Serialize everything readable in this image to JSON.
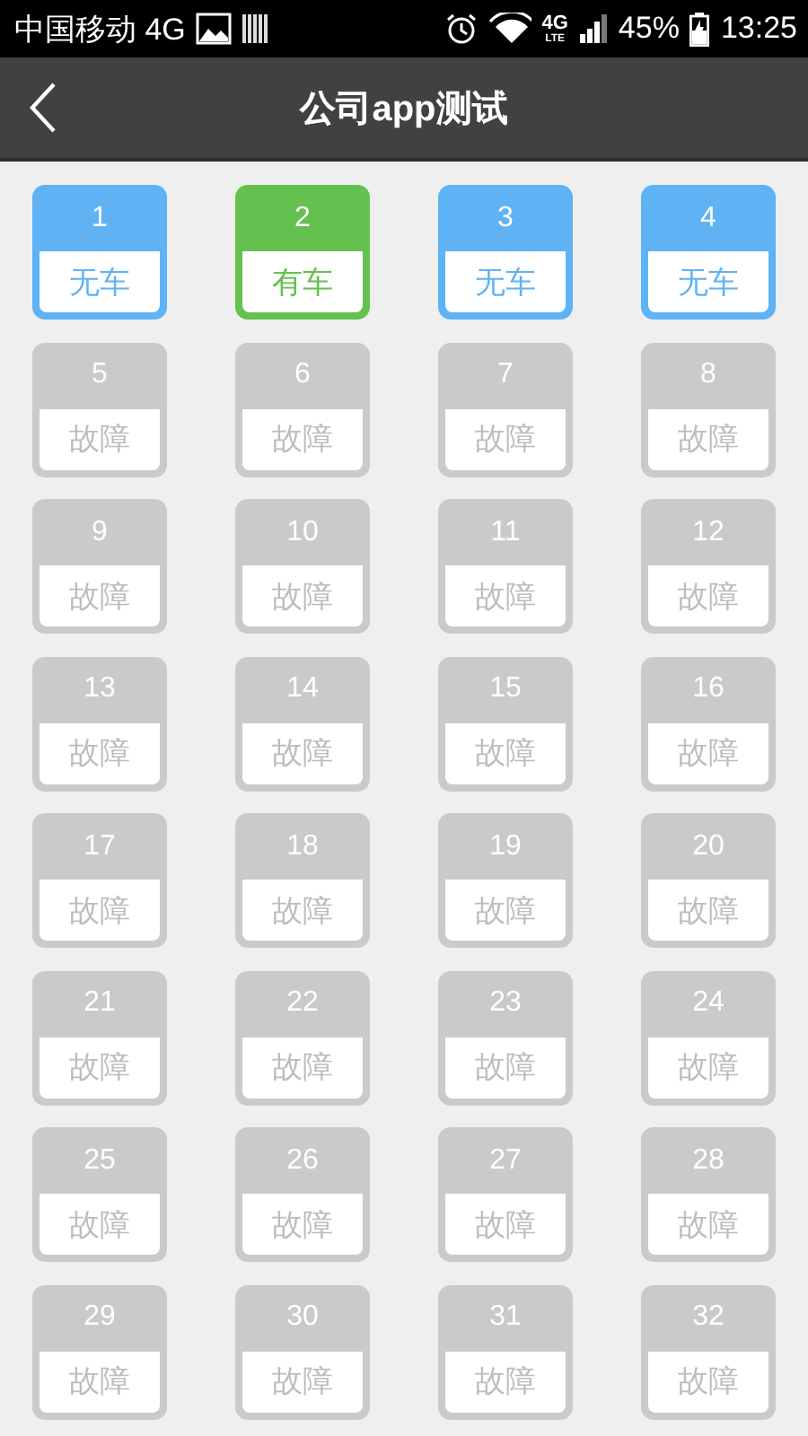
{
  "status_bar": {
    "carrier": "中国移动 4G",
    "network": "4G",
    "network_sub": "LTE",
    "battery": "45%",
    "time": "13:25"
  },
  "header": {
    "title": "公司app测试"
  },
  "slots": [
    {
      "number": "1",
      "status": "无车",
      "kind": "empty"
    },
    {
      "number": "2",
      "status": "有车",
      "kind": "occupied"
    },
    {
      "number": "3",
      "status": "无车",
      "kind": "empty"
    },
    {
      "number": "4",
      "status": "无车",
      "kind": "empty"
    },
    {
      "number": "5",
      "status": "故障",
      "kind": "fault"
    },
    {
      "number": "6",
      "status": "故障",
      "kind": "fault"
    },
    {
      "number": "7",
      "status": "故障",
      "kind": "fault"
    },
    {
      "number": "8",
      "status": "故障",
      "kind": "fault"
    },
    {
      "number": "9",
      "status": "故障",
      "kind": "fault"
    },
    {
      "number": "10",
      "status": "故障",
      "kind": "fault"
    },
    {
      "number": "11",
      "status": "故障",
      "kind": "fault"
    },
    {
      "number": "12",
      "status": "故障",
      "kind": "fault"
    },
    {
      "number": "13",
      "status": "故障",
      "kind": "fault"
    },
    {
      "number": "14",
      "status": "故障",
      "kind": "fault"
    },
    {
      "number": "15",
      "status": "故障",
      "kind": "fault"
    },
    {
      "number": "16",
      "status": "故障",
      "kind": "fault"
    },
    {
      "number": "17",
      "status": "故障",
      "kind": "fault"
    },
    {
      "number": "18",
      "status": "故障",
      "kind": "fault"
    },
    {
      "number": "19",
      "status": "故障",
      "kind": "fault"
    },
    {
      "number": "20",
      "status": "故障",
      "kind": "fault"
    },
    {
      "number": "21",
      "status": "故障",
      "kind": "fault"
    },
    {
      "number": "22",
      "status": "故障",
      "kind": "fault"
    },
    {
      "number": "23",
      "status": "故障",
      "kind": "fault"
    },
    {
      "number": "24",
      "status": "故障",
      "kind": "fault"
    },
    {
      "number": "25",
      "status": "故障",
      "kind": "fault"
    },
    {
      "number": "26",
      "status": "故障",
      "kind": "fault"
    },
    {
      "number": "27",
      "status": "故障",
      "kind": "fault"
    },
    {
      "number": "28",
      "status": "故障",
      "kind": "fault"
    },
    {
      "number": "29",
      "status": "故障",
      "kind": "fault"
    },
    {
      "number": "30",
      "status": "故障",
      "kind": "fault"
    },
    {
      "number": "31",
      "status": "故障",
      "kind": "fault"
    },
    {
      "number": "32",
      "status": "故障",
      "kind": "fault"
    }
  ]
}
